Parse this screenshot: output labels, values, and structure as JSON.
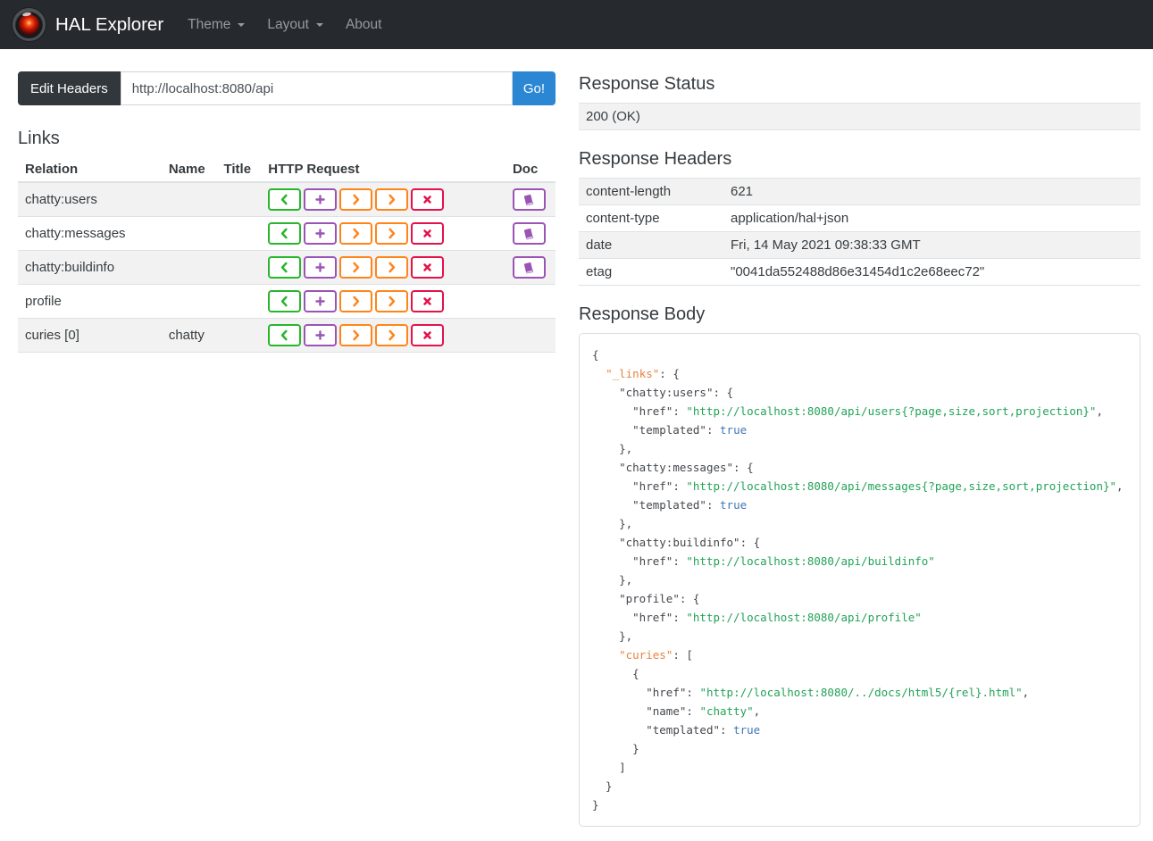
{
  "navbar": {
    "brand": "HAL Explorer",
    "items": [
      {
        "label": "Theme",
        "has_caret": true
      },
      {
        "label": "Layout",
        "has_caret": true
      },
      {
        "label": "About",
        "has_caret": false
      }
    ]
  },
  "toolbar": {
    "edit_headers_label": "Edit Headers",
    "url_value": "http://localhost:8080/api",
    "go_label": "Go!"
  },
  "links": {
    "title": "Links",
    "columns": [
      "Relation",
      "Name",
      "Title",
      "HTTP Request",
      "Doc"
    ],
    "http_buttons": [
      {
        "name": "get",
        "icon": "chevron-left-icon",
        "color": "#28b62c"
      },
      {
        "name": "post",
        "icon": "plus-icon",
        "color": "#9a55b4"
      },
      {
        "name": "put",
        "icon": "chevron-right-icon",
        "color": "#ff851b"
      },
      {
        "name": "patch",
        "icon": "chevron-right-icon",
        "color": "#ff851b"
      },
      {
        "name": "delete",
        "icon": "x-icon",
        "color": "#e3124a"
      }
    ],
    "doc_button": {
      "icon": "book-icon",
      "color": "#9a55b4"
    },
    "rows": [
      {
        "relation": "chatty:users",
        "name": "",
        "title": "",
        "doc": true
      },
      {
        "relation": "chatty:messages",
        "name": "",
        "title": "",
        "doc": true
      },
      {
        "relation": "chatty:buildinfo",
        "name": "",
        "title": "",
        "doc": true
      },
      {
        "relation": "profile",
        "name": "",
        "title": "",
        "doc": false
      },
      {
        "relation": "curies [0]",
        "name": "chatty",
        "title": "",
        "doc": false
      }
    ]
  },
  "response": {
    "status_title": "Response Status",
    "status_value": "200 (OK)",
    "headers_title": "Response Headers",
    "headers": [
      {
        "name": "content-length",
        "value": "621"
      },
      {
        "name": "content-type",
        "value": "application/hal+json"
      },
      {
        "name": "date",
        "value": "Fri, 14 May 2021 09:38:33 GMT"
      },
      {
        "name": "etag",
        "value": "\"0041da552488d86e31454d1c2e68eec72\""
      }
    ],
    "body_title": "Response Body",
    "body_lines": [
      [
        [
          "p",
          "{"
        ]
      ],
      [
        [
          "p",
          "  "
        ],
        [
          "ks",
          "\"_links\""
        ],
        [
          "p",
          ": {"
        ]
      ],
      [
        [
          "p",
          "    "
        ],
        [
          "k",
          "\"chatty:users\""
        ],
        [
          "p",
          ": {"
        ]
      ],
      [
        [
          "p",
          "      "
        ],
        [
          "k",
          "\"href\""
        ],
        [
          "p",
          ": "
        ],
        [
          "s",
          "\"http://localhost:8080/api/users{?page,size,sort,projection}\""
        ],
        [
          "p",
          ","
        ]
      ],
      [
        [
          "p",
          "      "
        ],
        [
          "k",
          "\"templated\""
        ],
        [
          "p",
          ": "
        ],
        [
          "b",
          "true"
        ]
      ],
      [
        [
          "p",
          "    },"
        ]
      ],
      [
        [
          "p",
          "    "
        ],
        [
          "k",
          "\"chatty:messages\""
        ],
        [
          "p",
          ": {"
        ]
      ],
      [
        [
          "p",
          "      "
        ],
        [
          "k",
          "\"href\""
        ],
        [
          "p",
          ": "
        ],
        [
          "s",
          "\"http://localhost:8080/api/messages{?page,size,sort,projection}\""
        ],
        [
          "p",
          ","
        ]
      ],
      [
        [
          "p",
          "      "
        ],
        [
          "k",
          "\"templated\""
        ],
        [
          "p",
          ": "
        ],
        [
          "b",
          "true"
        ]
      ],
      [
        [
          "p",
          "    },"
        ]
      ],
      [
        [
          "p",
          "    "
        ],
        [
          "k",
          "\"chatty:buildinfo\""
        ],
        [
          "p",
          ": {"
        ]
      ],
      [
        [
          "p",
          "      "
        ],
        [
          "k",
          "\"href\""
        ],
        [
          "p",
          ": "
        ],
        [
          "s",
          "\"http://localhost:8080/api/buildinfo\""
        ]
      ],
      [
        [
          "p",
          "    },"
        ]
      ],
      [
        [
          "p",
          "    "
        ],
        [
          "k",
          "\"profile\""
        ],
        [
          "p",
          ": {"
        ]
      ],
      [
        [
          "p",
          "      "
        ],
        [
          "k",
          "\"href\""
        ],
        [
          "p",
          ": "
        ],
        [
          "s",
          "\"http://localhost:8080/api/profile\""
        ]
      ],
      [
        [
          "p",
          "    },"
        ]
      ],
      [
        [
          "p",
          "    "
        ],
        [
          "ks",
          "\"curies\""
        ],
        [
          "p",
          ": ["
        ]
      ],
      [
        [
          "p",
          "      {"
        ]
      ],
      [
        [
          "p",
          "        "
        ],
        [
          "k",
          "\"href\""
        ],
        [
          "p",
          ": "
        ],
        [
          "s",
          "\"http://localhost:8080/../docs/html5/{rel}.html\""
        ],
        [
          "p",
          ","
        ]
      ],
      [
        [
          "p",
          "        "
        ],
        [
          "k",
          "\"name\""
        ],
        [
          "p",
          ": "
        ],
        [
          "s",
          "\"chatty\""
        ],
        [
          "p",
          ","
        ]
      ],
      [
        [
          "p",
          "        "
        ],
        [
          "k",
          "\"templated\""
        ],
        [
          "p",
          ": "
        ],
        [
          "b",
          "true"
        ]
      ],
      [
        [
          "p",
          "      }"
        ]
      ],
      [
        [
          "p",
          "    ]"
        ]
      ],
      [
        [
          "p",
          "  }"
        ]
      ],
      [
        [
          "p",
          "}"
        ]
      ]
    ]
  },
  "colors": {
    "accent": "#2b87d3",
    "navbar_bg": "#26292d",
    "stripe_bg": "#f2f2f2",
    "get_green": "#28b62c",
    "post_purple": "#9a55b4",
    "put_patch_orange": "#ff851b",
    "delete_red": "#e3124a",
    "doc_purple": "#9a55b4",
    "json_key": "#43474c",
    "json_special_key": "#e8823e",
    "json_string": "#23a258",
    "json_boolean": "#3d77b6"
  }
}
